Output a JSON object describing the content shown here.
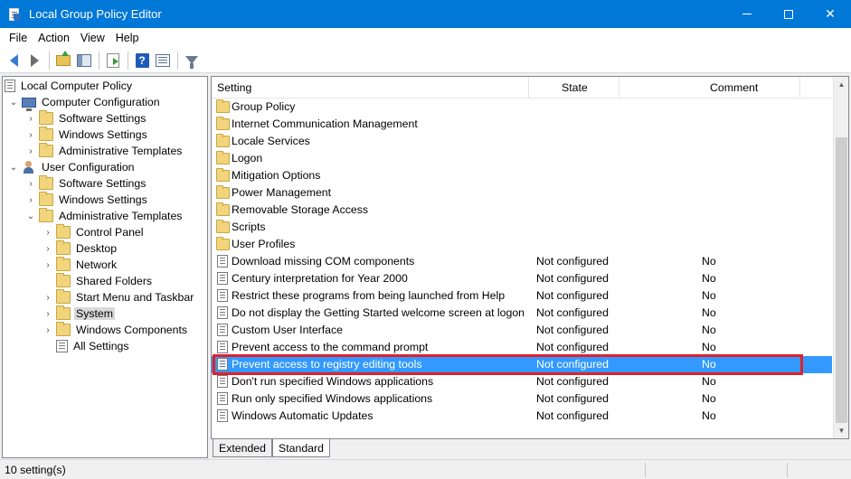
{
  "window": {
    "title": "Local Group Policy Editor",
    "controls": {
      "minimize": "",
      "maximize": "",
      "close": "✕"
    }
  },
  "menu": [
    "File",
    "Action",
    "View",
    "Help"
  ],
  "toolbar": {
    "buttons": [
      "back-arrow-icon",
      "forward-arrow-icon",
      "up-folder-icon",
      "show-hide-console-tree-icon",
      "export-list-icon",
      "help-icon",
      "properties-icon",
      "filter-icon"
    ]
  },
  "tree": [
    {
      "label": "Local Computer Policy",
      "level": 0,
      "chevron": "",
      "icon": "policy-doc"
    },
    {
      "label": "Computer Configuration",
      "level": 1,
      "chevron": "⌄",
      "icon": "computer"
    },
    {
      "label": "Software Settings",
      "level": 2,
      "chevron": "›",
      "icon": "folder"
    },
    {
      "label": "Windows Settings",
      "level": 2,
      "chevron": "›",
      "icon": "folder"
    },
    {
      "label": "Administrative Templates",
      "level": 2,
      "chevron": "›",
      "icon": "folder"
    },
    {
      "label": "User Configuration",
      "level": 1,
      "chevron": "⌄",
      "icon": "user"
    },
    {
      "label": "Software Settings",
      "level": 2,
      "chevron": "›",
      "icon": "folder"
    },
    {
      "label": "Windows Settings",
      "level": 2,
      "chevron": "›",
      "icon": "folder"
    },
    {
      "label": "Administrative Templates",
      "level": 2,
      "chevron": "⌄",
      "icon": "folder"
    },
    {
      "label": "Control Panel",
      "level": 3,
      "chevron": "›",
      "icon": "folder"
    },
    {
      "label": "Desktop",
      "level": 3,
      "chevron": "›",
      "icon": "folder"
    },
    {
      "label": "Network",
      "level": 3,
      "chevron": "›",
      "icon": "folder"
    },
    {
      "label": "Shared Folders",
      "level": 3,
      "chevron": "",
      "icon": "folder"
    },
    {
      "label": "Start Menu and Taskbar",
      "level": 3,
      "chevron": "›",
      "icon": "folder"
    },
    {
      "label": "System",
      "level": 3,
      "chevron": "›",
      "icon": "folder",
      "selected": true
    },
    {
      "label": "Windows Components",
      "level": 3,
      "chevron": "›",
      "icon": "folder"
    },
    {
      "label": "All Settings",
      "level": 3,
      "chevron": "",
      "icon": "all-settings"
    }
  ],
  "list": {
    "columns": {
      "setting": "Setting",
      "state": "State",
      "comment": "Comment"
    },
    "rows": [
      {
        "name": "Group Policy",
        "state": "",
        "comment": "",
        "icon": "folder"
      },
      {
        "name": "Internet Communication Management",
        "state": "",
        "comment": "",
        "icon": "folder"
      },
      {
        "name": "Locale Services",
        "state": "",
        "comment": "",
        "icon": "folder"
      },
      {
        "name": "Logon",
        "state": "",
        "comment": "",
        "icon": "folder"
      },
      {
        "name": "Mitigation Options",
        "state": "",
        "comment": "",
        "icon": "folder"
      },
      {
        "name": "Power Management",
        "state": "",
        "comment": "",
        "icon": "folder"
      },
      {
        "name": "Removable Storage Access",
        "state": "",
        "comment": "",
        "icon": "folder"
      },
      {
        "name": "Scripts",
        "state": "",
        "comment": "",
        "icon": "folder"
      },
      {
        "name": "User Profiles",
        "state": "",
        "comment": "",
        "icon": "folder"
      },
      {
        "name": "Download missing COM components",
        "state": "Not configured",
        "comment": "No",
        "icon": "policy"
      },
      {
        "name": "Century interpretation for Year 2000",
        "state": "Not configured",
        "comment": "No",
        "icon": "policy"
      },
      {
        "name": "Restrict these programs from being launched from Help",
        "state": "Not configured",
        "comment": "No",
        "icon": "policy"
      },
      {
        "name": "Do not display the Getting Started welcome screen at logon",
        "state": "Not configured",
        "comment": "No",
        "icon": "policy"
      },
      {
        "name": "Custom User Interface",
        "state": "Not configured",
        "comment": "No",
        "icon": "policy"
      },
      {
        "name": "Prevent access to the command prompt",
        "state": "Not configured",
        "comment": "No",
        "icon": "policy"
      },
      {
        "name": "Prevent access to registry editing tools",
        "state": "Not configured",
        "comment": "No",
        "icon": "policy",
        "selected": true
      },
      {
        "name": "Don't run specified Windows applications",
        "state": "Not configured",
        "comment": "No",
        "icon": "policy"
      },
      {
        "name": "Run only specified Windows applications",
        "state": "Not configured",
        "comment": "No",
        "icon": "policy"
      },
      {
        "name": "Windows Automatic Updates",
        "state": "Not configured",
        "comment": "No",
        "icon": "policy"
      }
    ]
  },
  "tabs": [
    "Extended",
    "Standard"
  ],
  "status": {
    "text": "10 setting(s)"
  },
  "colors": {
    "titlebar": "#0078d7",
    "selection": "#3399ff",
    "highlight_border": "#e0202a"
  }
}
